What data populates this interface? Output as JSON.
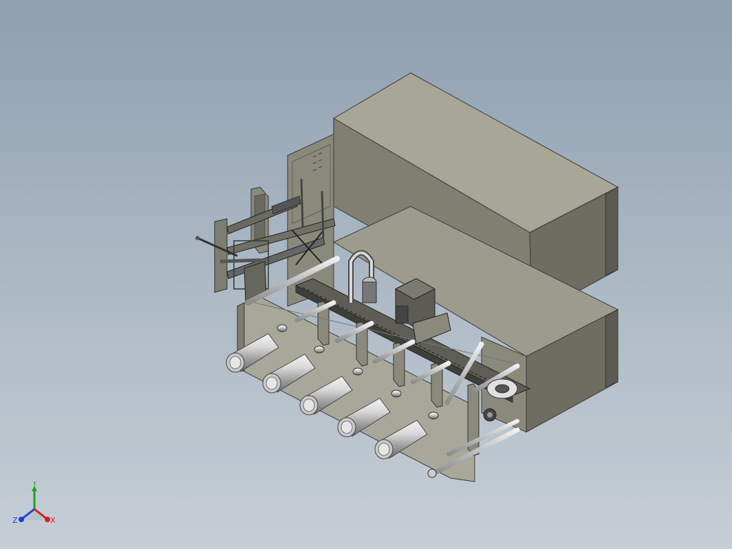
{
  "viewport": {
    "background_top": "#8e9fb0",
    "background_bottom": "#c6ced6",
    "model_color": "#8f8f82"
  },
  "triad": {
    "x_label": "X",
    "y_label": "Y",
    "z_label": "Z",
    "x_color": "#d81e1e",
    "y_color": "#1fa31f",
    "z_color": "#1f3fd8"
  }
}
